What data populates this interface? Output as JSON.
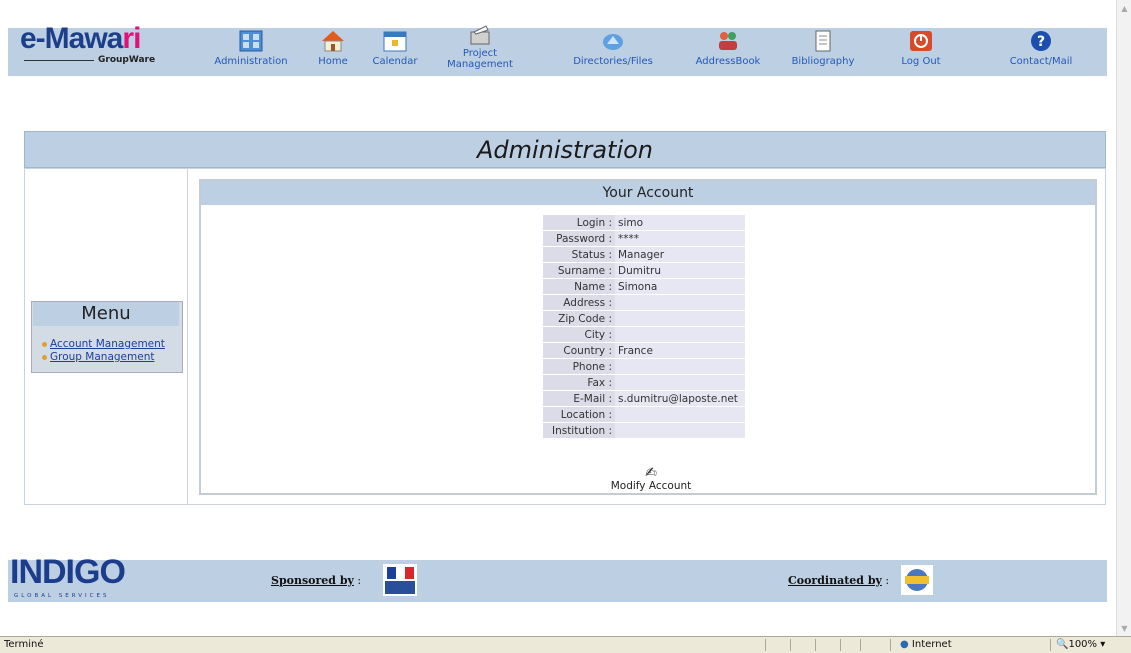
{
  "brand": {
    "logo_main": "e-Mawa",
    "logo_r": "r",
    "logo_i": "i",
    "logo_sub": "GroupWare"
  },
  "nav": [
    {
      "label": "Administration",
      "icon": "administration-icon"
    },
    {
      "label": "Home",
      "icon": "home-icon"
    },
    {
      "label": "Calendar",
      "icon": "calendar-icon"
    },
    {
      "label": "Project Management",
      "icon": "project-management-icon"
    },
    {
      "label": "Directories/Files",
      "icon": "folder-icon"
    },
    {
      "label": "AddressBook",
      "icon": "addressbook-icon"
    },
    {
      "label": "Bibliography",
      "icon": "bibliography-icon"
    },
    {
      "label": "Log Out",
      "icon": "power-icon"
    },
    {
      "label": "Contact/Mail",
      "icon": "help-icon"
    }
  ],
  "page_title": "Administration",
  "menu": {
    "title": "Menu",
    "items": [
      "Account Management",
      "Group Management"
    ]
  },
  "account": {
    "title": "Your Account",
    "fields": [
      {
        "key": "Login :",
        "value": "simo"
      },
      {
        "key": "Password :",
        "value": "****"
      },
      {
        "key": "Status :",
        "value": "Manager"
      },
      {
        "key": "Surname :",
        "value": "Dumitru"
      },
      {
        "key": "Name :",
        "value": "Simona"
      },
      {
        "key": "Address :",
        "value": ""
      },
      {
        "key": "Zip Code :",
        "value": ""
      },
      {
        "key": "City :",
        "value": ""
      },
      {
        "key": "Country :",
        "value": "France"
      },
      {
        "key": "Phone :",
        "value": ""
      },
      {
        "key": "Fax :",
        "value": ""
      },
      {
        "key": "E-Mail :",
        "value": "s.dumitru@laposte.net"
      },
      {
        "key": "Location :",
        "value": ""
      },
      {
        "key": "Institution :",
        "value": ""
      }
    ],
    "modify_label": "Modify Account"
  },
  "footer": {
    "logo": "INDIGO",
    "logo_sub": "GLOBAL SERVICES",
    "sponsored": "Sponsored by",
    "coordinated": "Coordinated by"
  },
  "statusbar": {
    "status": "Terminé",
    "zone": "Internet",
    "zoom": "100%"
  },
  "colors": {
    "bar": "#bccfe3",
    "link": "#2458b8",
    "accent": "#e2117a"
  }
}
